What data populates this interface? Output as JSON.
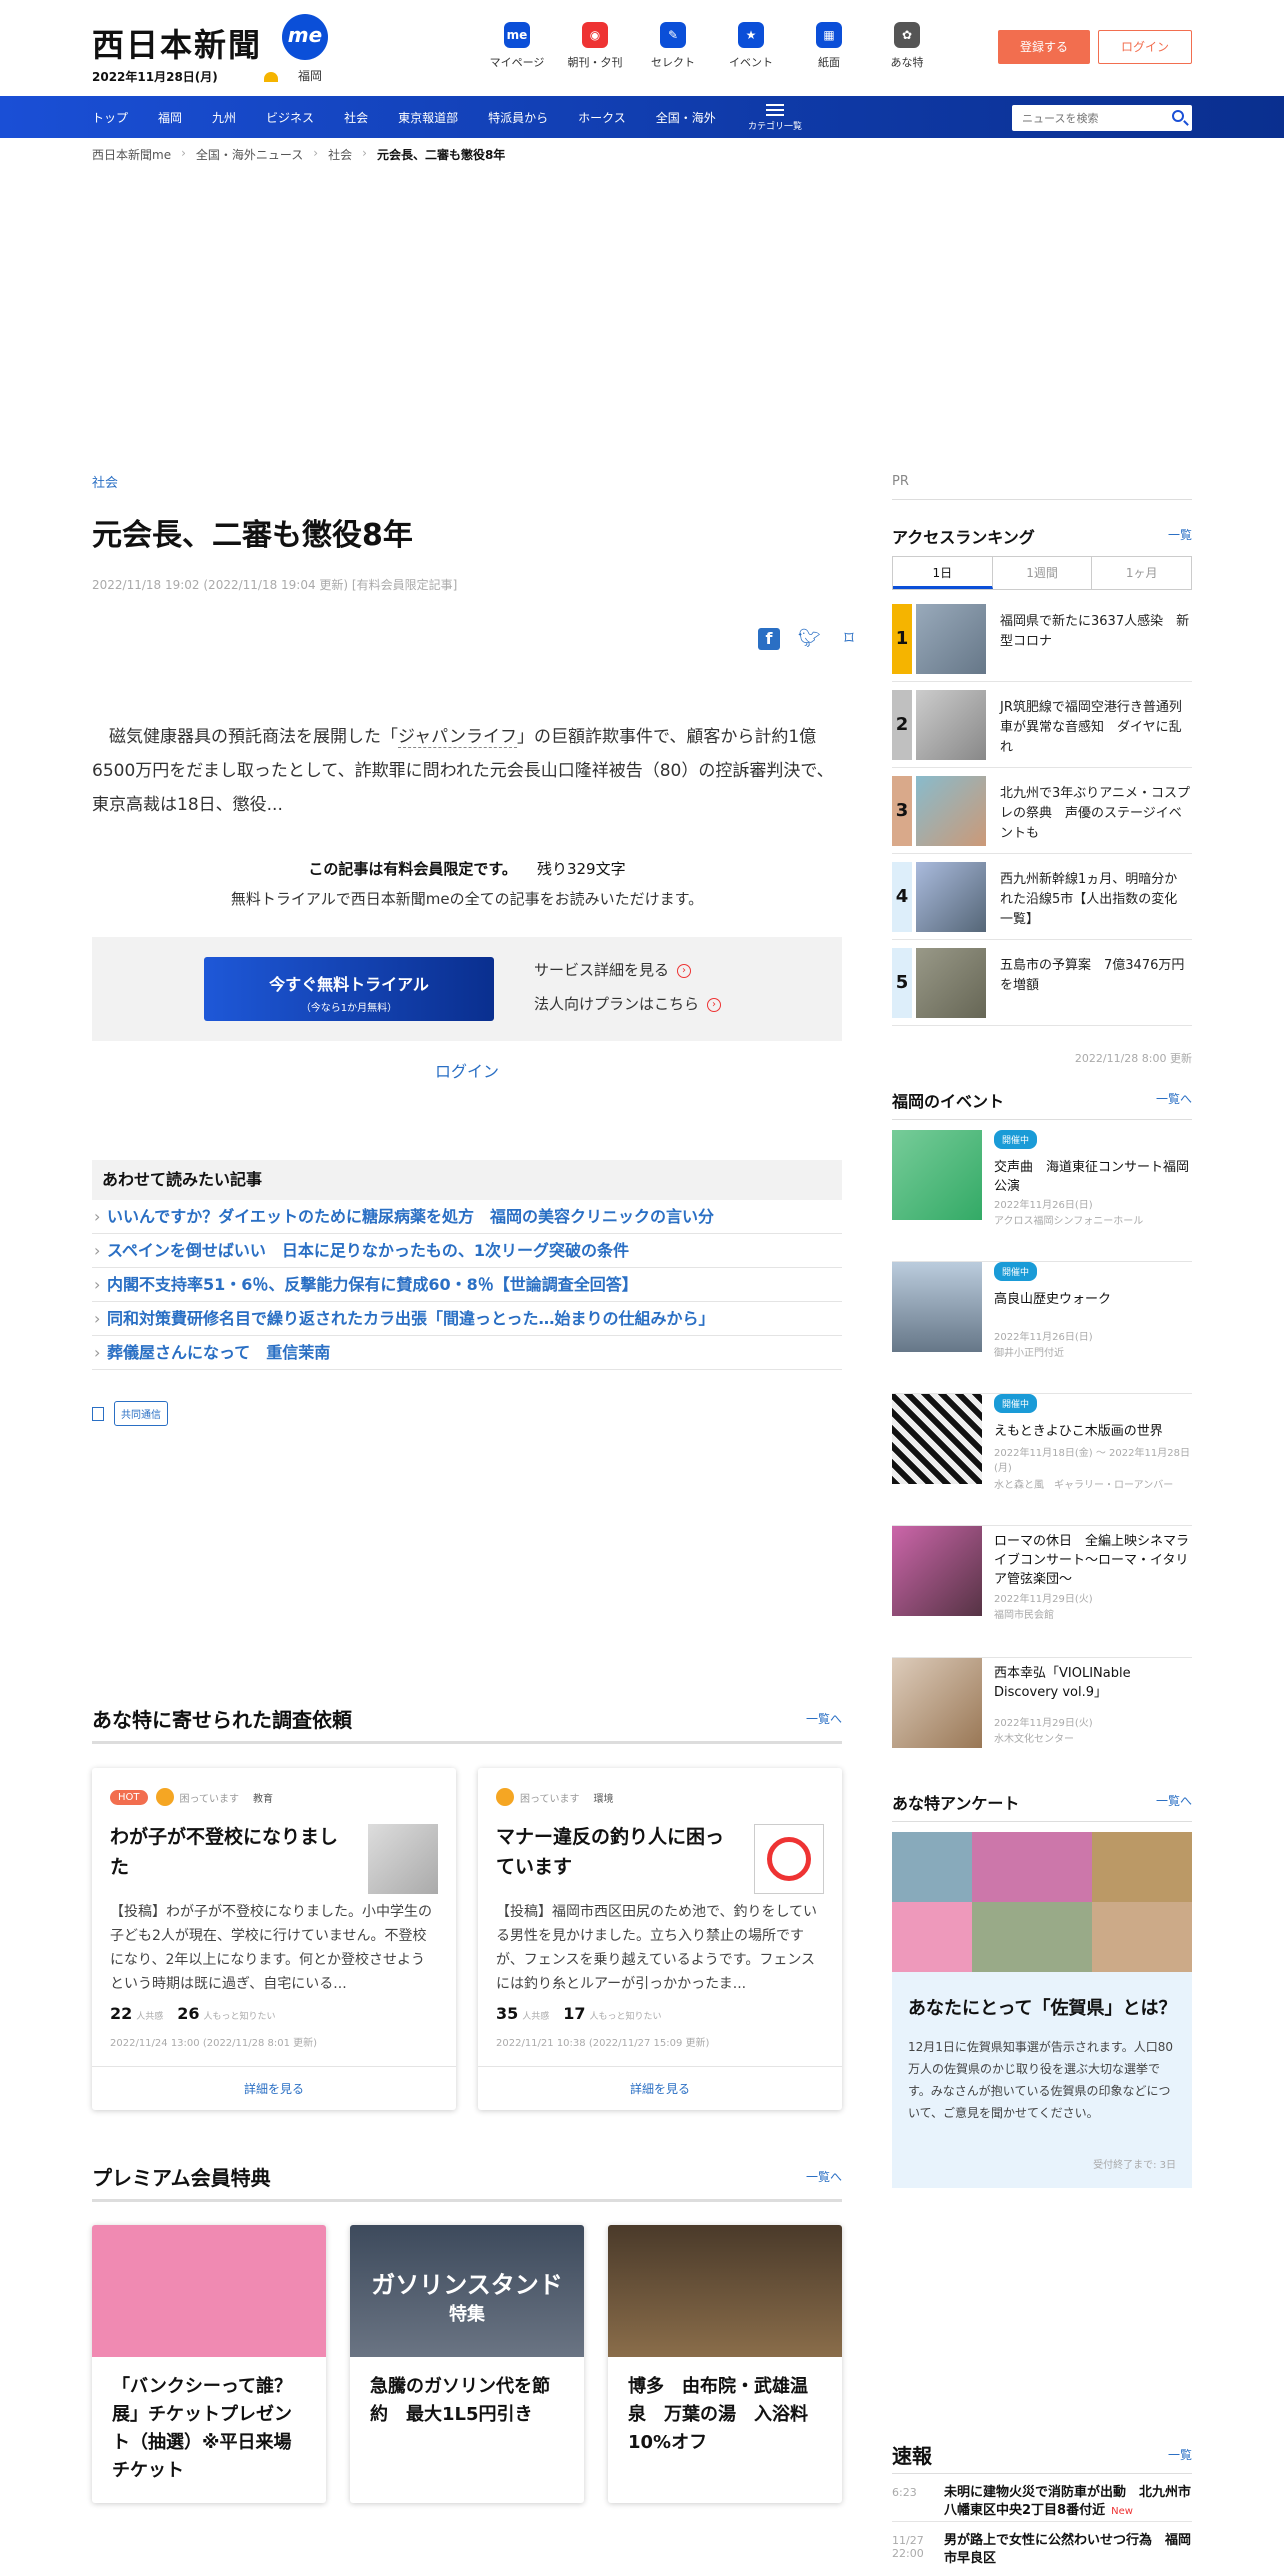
{
  "header": {
    "logo": "西日本新聞",
    "logo_badge": "me",
    "date": "2022年11月28日(月)",
    "weather_city": "福岡",
    "nav": [
      {
        "label": "マイページ",
        "glyph": "me"
      },
      {
        "label": "朝刊・夕刊",
        "glyph": "◉"
      },
      {
        "label": "セレクト",
        "glyph": "✎"
      },
      {
        "label": "イベント",
        "glyph": "★"
      },
      {
        "label": "紙面",
        "glyph": "▦"
      },
      {
        "label": "あな特",
        "glyph": "✿"
      }
    ],
    "register": "登録する",
    "login": "ログイン"
  },
  "navbar": {
    "items": [
      "トップ",
      "福岡",
      "九州",
      "ビジネス",
      "社会",
      "東京報道部",
      "特派員から",
      "ホークス",
      "全国・海外"
    ],
    "category": "カテゴリ一覧",
    "search_placeholder": "ニュースを検索"
  },
  "breadcrumb": [
    "西日本新聞me",
    "全国・海外ニュース",
    "社会",
    "元会長、二審も懲役8年"
  ],
  "article": {
    "category": "社会",
    "title": "元会長、二審も懲役8年",
    "meta": "2022/11/18 19:02 (2022/11/18 19:04 更新) [有料会員限定記事]",
    "lead_pre": "磁気健康器具の預託商法を展開した「",
    "lead_link": "ジャパンライフ",
    "lead_post": "」の巨額詐欺事件で、顧客から計約1億6500万円をだまし取ったとして、詐欺罪に問われた元会長山口隆祥被告（80）の控訴審判決で、東京高裁は18日、懲役...",
    "paywall_title": "この記事は有料会員限定です。",
    "remaining": "残り329文字",
    "paywall_sub": "無料トライアルで西日本新聞meの全ての記事をお読みいただけます。",
    "trial_btn": "今すぐ無料トライアル",
    "trial_sub": "（今なら1か月無料）",
    "service_link": "サービス詳細を見る",
    "corp_link": "法人向けプランはこちら",
    "login": "ログイン"
  },
  "related": {
    "heading": "あわせて読みたい記事",
    "items": [
      "いいんですか？ダイエットのために糖尿病薬を処方　福岡の美容クリニックの言い分",
      "スペインを倒せばいい　日本に足りなかったもの、1次リーグ突破の条件",
      "内閣不支持率51・6％、反撃能力保有に賛成60・8％【世論調査全回答】",
      "同和対策費研修名目で繰り返されたカラ出張「間違っとった…始まりの仕組みから」",
      "葬儀屋さんになって　重信茉南"
    ],
    "source": "共同通信"
  },
  "surveys": {
    "heading": "あな特に寄せられた調査依頼",
    "more": "一覧へ",
    "cards": [
      {
        "hot": "HOT",
        "mood": "困っています",
        "tag": "教育",
        "title": "わが子が不登校になりました",
        "body": "【投稿】わが子が不登校になりました。小中学生の子ども2人が現在、学校に行けていません。不登校になり、2年以上になります。何とか登校させようという時期は既に過ぎ、自宅にいる...",
        "n1": "22",
        "n1_label": "人共感",
        "n2": "26",
        "n2_label": "人もっと知りたい",
        "date": "2022/11/24 13:00 (2022/11/28 8:01 更新)",
        "detail": "詳細を見る"
      },
      {
        "mood": "困っています",
        "tag": "環境",
        "title": "マナー違反の釣り人に困っています",
        "body": "【投稿】福岡市西区田尻のため池で、釣りをしている男性を見かけました。立ち入り禁止の場所ですが、フェンスを乗り越えているようです。フェンスには釣り糸とルアーが引っかかったま...",
        "n1": "35",
        "n1_label": "人共感",
        "n2": "17",
        "n2_label": "人もっと知りたい",
        "date": "2022/11/21 10:38 (2022/11/27 15:09 更新)",
        "detail": "詳細を見る"
      }
    ]
  },
  "premium": {
    "heading": "プレミアム会員特典",
    "more": "一覧へ",
    "cards": [
      {
        "caption": "「バンクシーって誰？展」チケットプレゼント（抽選）※平日来場チケット"
      },
      {
        "caption": "急騰のガソリン代を節約　最大1L5円引き",
        "overlay1": "ガソリンスタンド",
        "overlay2": "特集"
      },
      {
        "caption": "博多　由布院・武雄温泉　万葉の湯　入浴料10%オフ"
      }
    ]
  },
  "sidebar": {
    "pr": "PR",
    "ranking": {
      "heading": "アクセスランキング",
      "more": "一覧",
      "tabs": [
        "1日",
        "1週間",
        "1ヶ月"
      ],
      "items": [
        {
          "rank": "1",
          "text": "福岡県で新たに3637人感染　新型コロナ"
        },
        {
          "rank": "2",
          "text": "JR筑肥線で福岡空港行き普通列車が異常な音感知　ダイヤに乱れ"
        },
        {
          "rank": "3",
          "text": "北九州で3年ぶりアニメ・コスプレの祭典　声優のステージイベントも"
        },
        {
          "rank": "4",
          "text": "西九州新幹線1ヵ月、明暗分かれた沿線5市【人出指数の変化一覧】"
        },
        {
          "rank": "5",
          "text": "五島市の予算案　7億3476万円を増額"
        }
      ],
      "updated": "2022/11/28 8:00 更新"
    },
    "events": {
      "heading": "福岡のイベント",
      "more": "一覧へ",
      "items": [
        {
          "badge": "開催中",
          "name": "交声曲　海道東征コンサート福岡公演",
          "date": "2022年11月26日(日)",
          "place": "アクロス福岡シンフォニーホール"
        },
        {
          "badge": "開催中",
          "name": "高良山歴史ウォーク",
          "date": "2022年11月26日(日)",
          "place": "御井小正門付近"
        },
        {
          "badge": "開催中",
          "name": "えもときよひこ木版画の世界",
          "date": "2022年11月18日(金) 〜 2022年11月28日(月)",
          "place": "水と森と風　ギャラリー・ローアンバー"
        },
        {
          "name": "ローマの休日　全編上映シネマライブコンサート～ローマ・イタリア管弦楽団～",
          "date": "2022年11月29日(火)",
          "place": "福岡市民会館"
        },
        {
          "name": "西本幸弘「VIOLINable Discovery vol.9」",
          "date": "2022年11月29日(火)",
          "place": "水木文化センター"
        }
      ]
    },
    "enquete": {
      "heading": "あな特アンケート",
      "more": "一覧へ",
      "question": "あなたにとって「佐賀県」とは？",
      "body": "12月1日に佐賀県知事選が告示されます。人口80万人の佐賀県のかじ取り役を選ぶ大切な選挙です。みなさんが抱いている佐賀県の印象などについて、ご意見を聞かせてください。",
      "until": "受付終了まで: 3日"
    },
    "flash": {
      "heading": "速報",
      "more": "一覧",
      "items": [
        {
          "time": "6:23",
          "text": "未明に建物火災で消防車が出動　北九州市八幡東区中央2丁目8番付近",
          "new": "New"
        },
        {
          "time": "11/27 22:00",
          "text": "男が路上で女性に公然わいせつ行為　福岡市早良区"
        }
      ]
    }
  },
  "colors": {
    "brand_blue": "#0b4fd8",
    "accent_orange": "#f26e4f",
    "link_blue": "#2a6fc4"
  }
}
